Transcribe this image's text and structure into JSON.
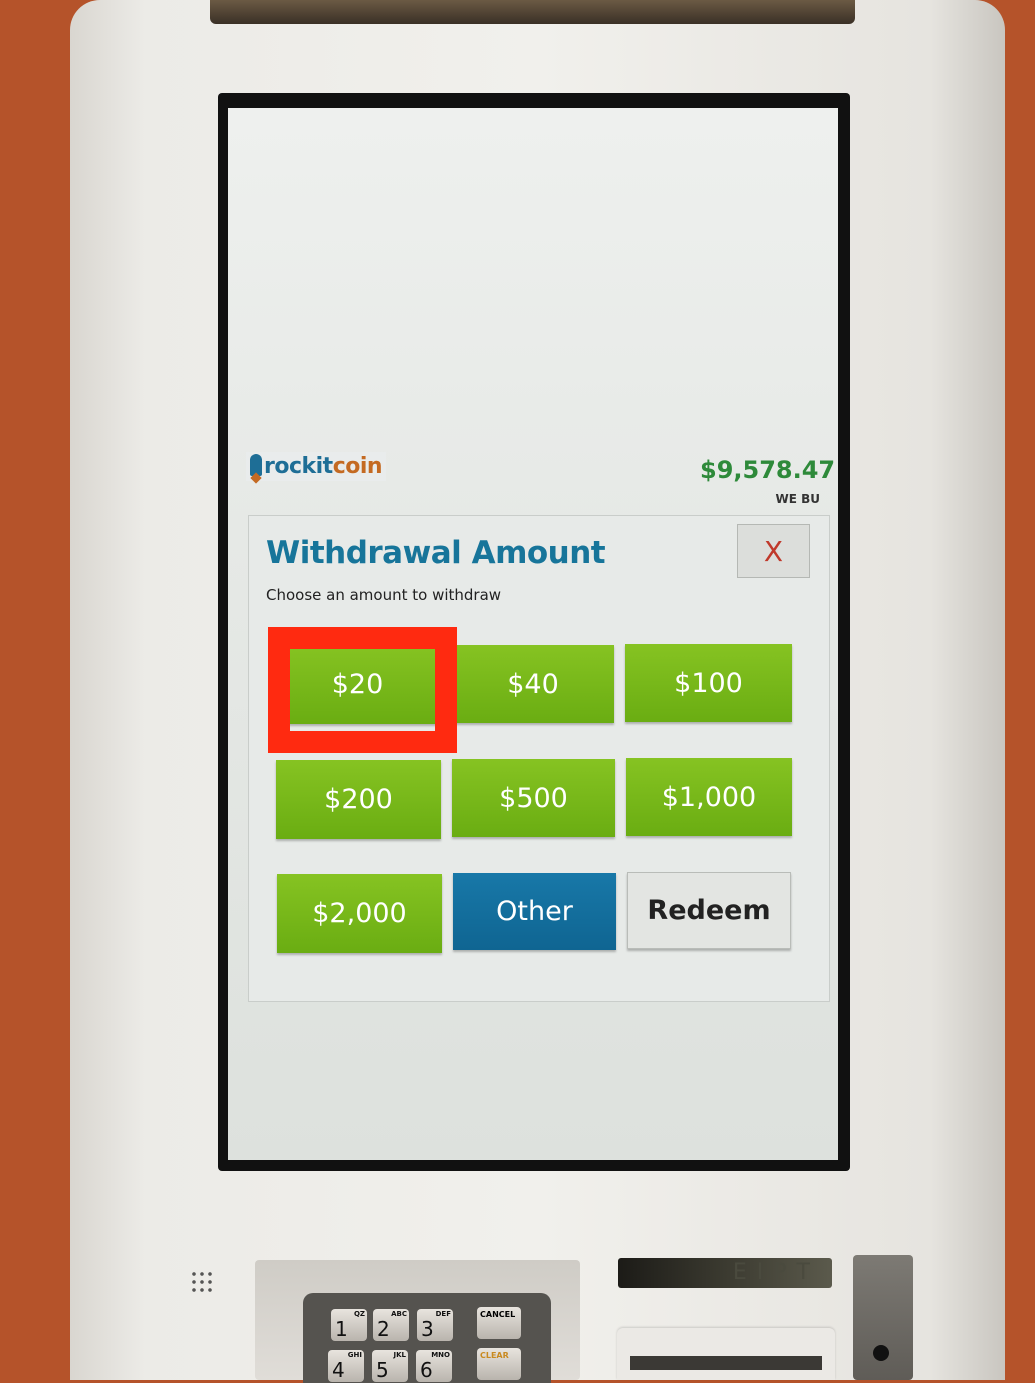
{
  "header": {
    "logo_part1": "rockit",
    "logo_part2": "coin",
    "price": "$9,578.47",
    "price_label": "WE BU"
  },
  "dialog": {
    "title": "Withdrawal Amount",
    "subtitle": "Choose an amount to withdraw",
    "close_label": "X",
    "buttons": [
      {
        "label": "$20"
      },
      {
        "label": "$40"
      },
      {
        "label": "$100"
      },
      {
        "label": "$200"
      },
      {
        "label": "$500"
      },
      {
        "label": "$1,000"
      },
      {
        "label": "$2,000"
      },
      {
        "label": "Other"
      },
      {
        "label": "Redeem"
      }
    ],
    "highlighted": "$20"
  },
  "keypad": {
    "keys": [
      {
        "num": "1",
        "letters": "QZ"
      },
      {
        "num": "2",
        "letters": "ABC"
      },
      {
        "num": "3",
        "letters": "DEF"
      },
      {
        "num": "4",
        "letters": "GHI"
      },
      {
        "num": "5",
        "letters": "JKL"
      },
      {
        "num": "6",
        "letters": "MNO"
      }
    ],
    "cancel": "CANCEL",
    "clear": "CLEAR"
  },
  "receipt_label": "EIPT",
  "colors": {
    "green": "#7ab81a",
    "blue": "#0f6b99",
    "title": "#17759a",
    "price": "#2e8a3a",
    "highlight": "#ff2a10"
  }
}
